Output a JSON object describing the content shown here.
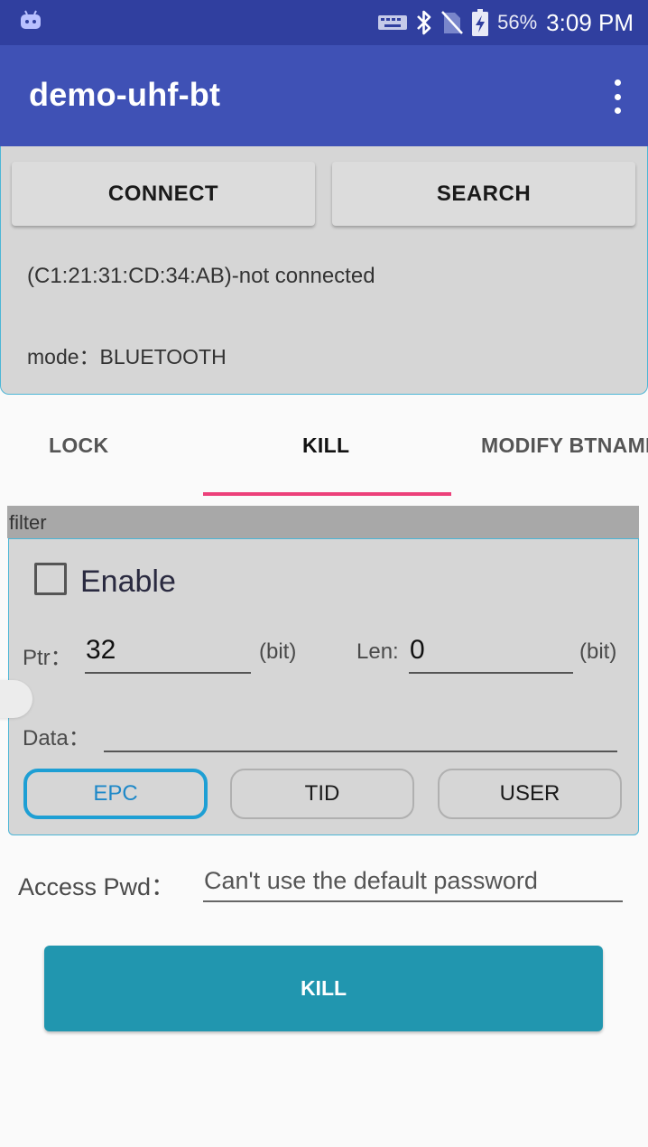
{
  "status_bar": {
    "battery_percent": "56%",
    "time": "3:09 PM",
    "icons": [
      "android-icon",
      "keyboard-icon",
      "bluetooth-icon",
      "no-sim-icon",
      "battery-charging-icon"
    ]
  },
  "app_bar": {
    "title": "demo-uhf-bt",
    "menu_icon": "overflow-menu-icon"
  },
  "connection": {
    "connect_label": "CONNECT",
    "search_label": "SEARCH",
    "status_text": "(C1:21:31:CD:34:AB)-not connected",
    "mode_text": "mode：BLUETOOTH"
  },
  "tabs": {
    "items": [
      {
        "label": "LOCK",
        "active": false
      },
      {
        "label": "KILL",
        "active": true
      },
      {
        "label": "MODIFY BTNAME",
        "active": false
      }
    ],
    "indicator_color": "#ec407a"
  },
  "filter": {
    "title": "filter",
    "enable_label": "Enable",
    "enable_checked": false,
    "ptr_label": "Ptr：",
    "ptr_value": "32",
    "ptr_unit": "(bit)",
    "len_label": "Len:",
    "len_value": "0",
    "len_unit": "(bit)",
    "data_label": "Data：",
    "data_value": "",
    "banks": [
      {
        "label": "EPC",
        "selected": true
      },
      {
        "label": "TID",
        "selected": false
      },
      {
        "label": "USER",
        "selected": false
      }
    ]
  },
  "access": {
    "label": "Access Pwd：",
    "placeholder": "Can't use the default password"
  },
  "kill_button": {
    "label": "KILL",
    "color": "#2196af"
  },
  "colors": {
    "status_bar": "#303f9f",
    "app_bar": "#3f51b5",
    "accent_border": "#4db6d6",
    "selected_bank": "#1e9fd4"
  }
}
